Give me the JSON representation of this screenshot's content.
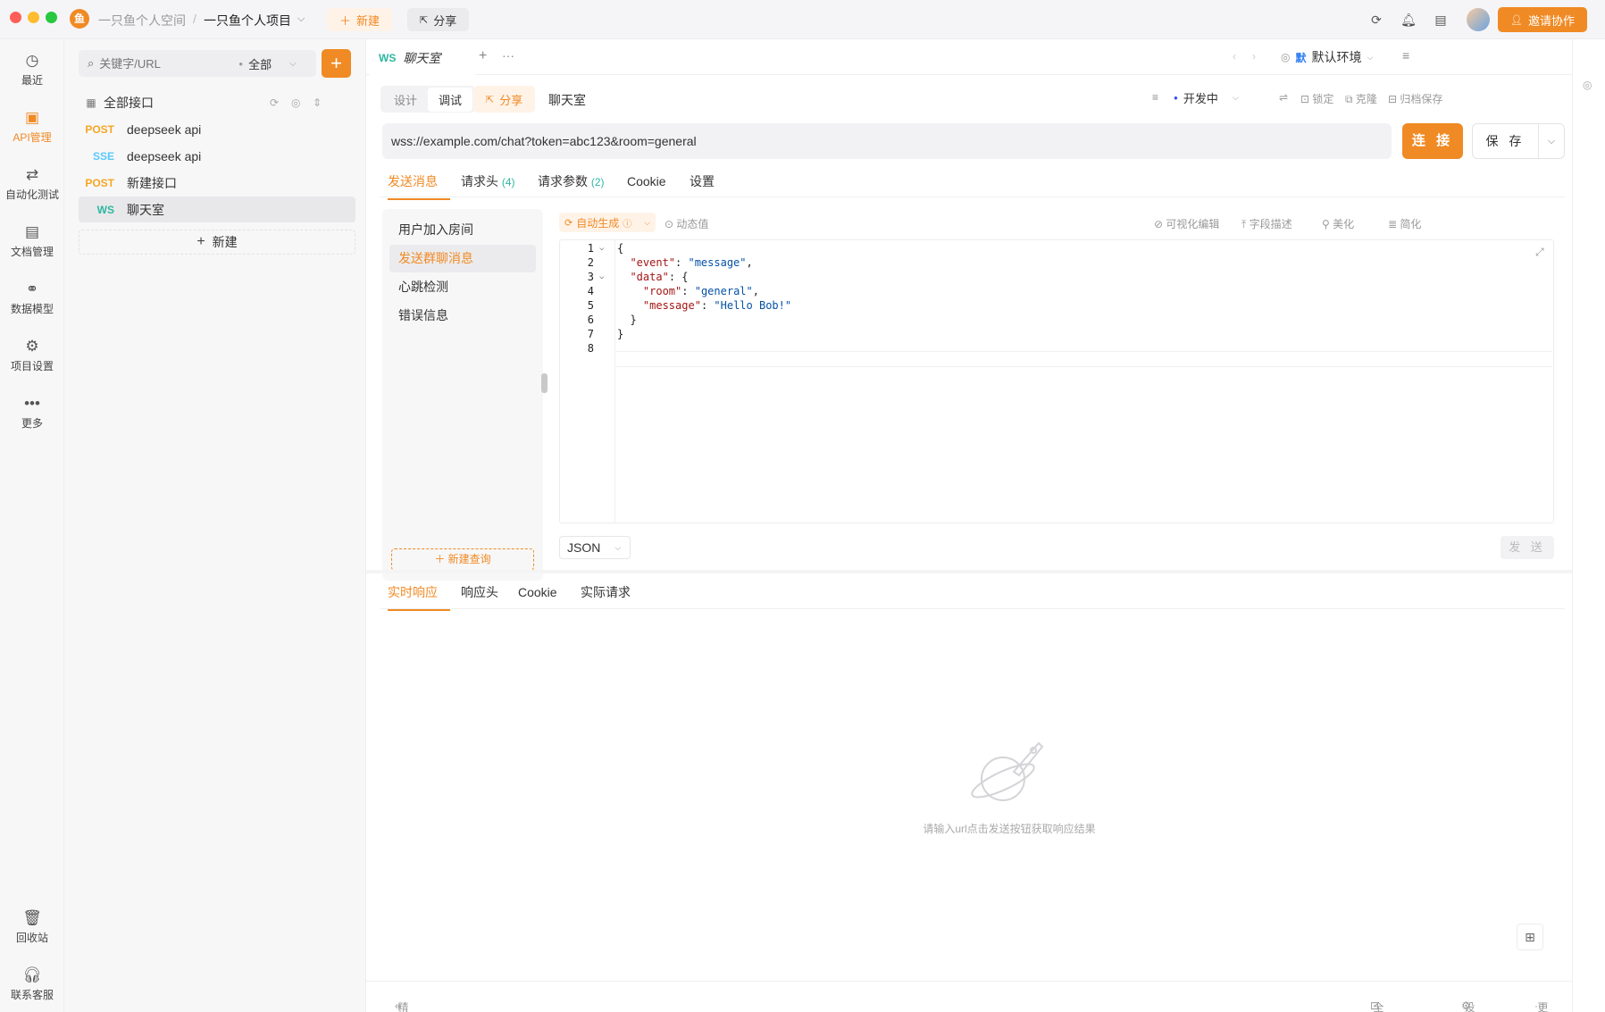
{
  "titlebar": {
    "workspace": "一只鱼个人空间",
    "separator": "/",
    "project": "一只鱼个人项目",
    "new_label": "新建",
    "share_label": "分享",
    "invite_label": "邀请协作",
    "logo_char": "鱼"
  },
  "rail": {
    "items": [
      {
        "label": "最近",
        "icon": "history-icon"
      },
      {
        "label": "API管理",
        "icon": "api-icon"
      },
      {
        "label": "自动化测试",
        "icon": "automation-icon"
      },
      {
        "label": "文档管理",
        "icon": "document-icon"
      },
      {
        "label": "数据模型",
        "icon": "data-model-icon"
      },
      {
        "label": "项目设置",
        "icon": "project-settings-icon"
      },
      {
        "label": "更多",
        "icon": "more-icon"
      }
    ],
    "bottom": [
      {
        "label": "回收站",
        "icon": "trash-icon"
      },
      {
        "label": "联系客服",
        "icon": "headset-icon"
      }
    ]
  },
  "sidebar": {
    "search_placeholder": "关键字/URL",
    "filter_value": "全部",
    "root_label": "全部接口",
    "items": [
      {
        "method": "POST",
        "name": "deepseek api",
        "color": "#f5a623"
      },
      {
        "method": "SSE",
        "name": "deepseek api",
        "color": "#5ac8fa"
      },
      {
        "method": "POST",
        "name": "新建接口",
        "color": "#f5a623"
      },
      {
        "method": "WS",
        "name": "聊天室",
        "color": "#2db7a0"
      }
    ],
    "new_label": "新建"
  },
  "doc_tab": {
    "badge": "WS",
    "title": "聊天室",
    "env_badge": "默",
    "env_label": "默认环境"
  },
  "toolbar": {
    "mode_design": "设计",
    "mode_debug": "调试",
    "share_label": "分享",
    "api_name": "聊天室",
    "status_label": "开发中",
    "lock_label": "锁定",
    "clone_label": "克隆",
    "archive_label": "归档保存"
  },
  "request": {
    "url": "wss://example.com/chat?token=abc123&room=general",
    "connect_label": "连 接",
    "save_label": "保 存"
  },
  "sub_tabs": {
    "send": "发送消息",
    "headers": "请求头",
    "headers_count": "(4)",
    "params": "请求参数",
    "params_count": "(2)",
    "cookie": "Cookie",
    "settings": "设置"
  },
  "messages": {
    "items": [
      "用户加入房间",
      "发送群聊消息",
      "心跳检测",
      "错误信息"
    ],
    "new_query": "新建查询"
  },
  "editor_toolbar": {
    "auto_gen": "自动生成",
    "dynamic": "动态值",
    "visual": "可视化编辑",
    "field_desc": "字段描述",
    "beautify": "美化",
    "simplify": "简化"
  },
  "code": {
    "line_numbers": [
      "1",
      "2",
      "3",
      "4",
      "5",
      "6",
      "7",
      "8"
    ],
    "l1": "{",
    "l2_key": "\"event\"",
    "l2_val": "\"message\"",
    "l3_key": "\"data\"",
    "l4_key": "\"room\"",
    "l4_val": "\"general\"",
    "l5_key": "\"message\"",
    "l5_val": "\"Hello Bob!\"",
    "l6": "}",
    "l7": "}"
  },
  "format": {
    "selected": "JSON",
    "send_label": "发 送"
  },
  "response_tabs": {
    "realtime": "实时响应",
    "headers": "响应头",
    "cookie": "Cookie",
    "actual": "实际请求"
  },
  "empty_state": {
    "message": "请输入url点击发送按钮获取响应结果"
  },
  "status_bar": {
    "compact": "精简模式",
    "global_params": "全局参数",
    "settings": "设置",
    "more": "更多"
  },
  "colors": {
    "accent": "#f08a24",
    "ws": "#2db7a0",
    "post": "#f5a623",
    "sse": "#5ac8fa"
  }
}
